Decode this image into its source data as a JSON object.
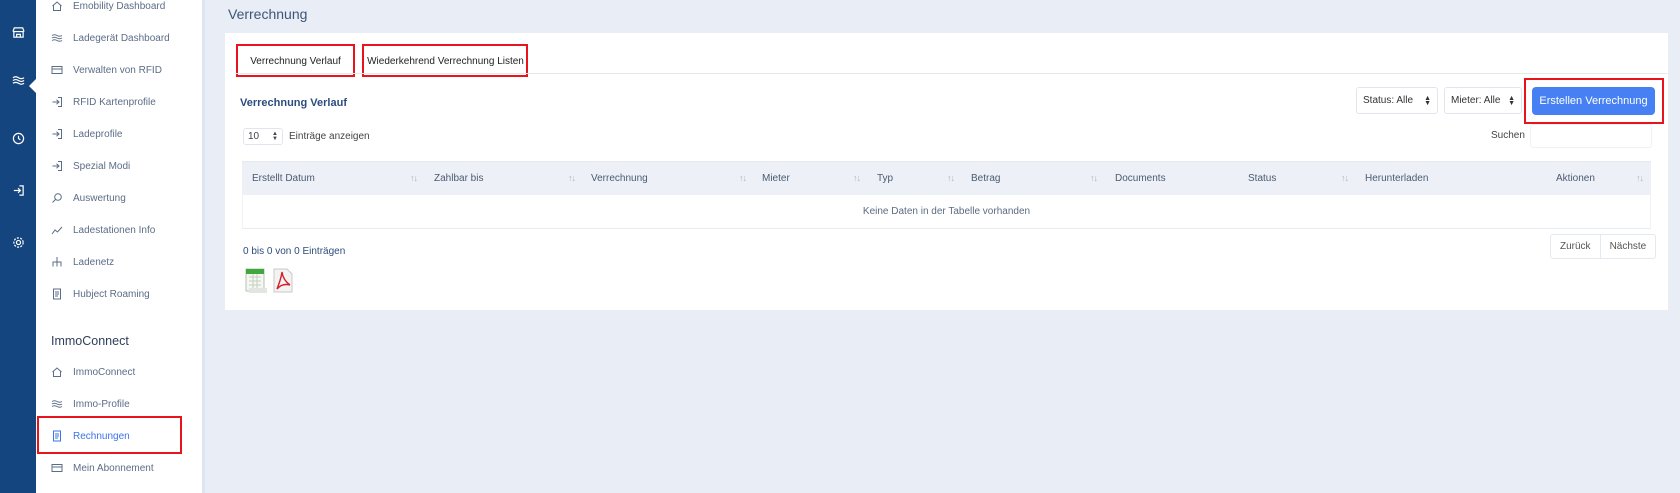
{
  "sidebar": {
    "items_top": [
      {
        "label": "Emobility Dashboard",
        "icon": "home-icon"
      },
      {
        "label": "Ladegerät Dashboard",
        "icon": "waves-icon"
      },
      {
        "label": "Verwalten von RFID",
        "icon": "card-icon"
      },
      {
        "label": "RFID Kartenprofile",
        "icon": "login-icon"
      },
      {
        "label": "Ladeprofile",
        "icon": "login-icon"
      },
      {
        "label": "Spezial Modi",
        "icon": "login-icon"
      },
      {
        "label": "Auswertung",
        "icon": "search-icon"
      },
      {
        "label": "Ladestationen Info",
        "icon": "chart-line-icon"
      },
      {
        "label": "Ladenetz",
        "icon": "network-icon"
      },
      {
        "label": "Hubject Roaming",
        "icon": "document-icon"
      }
    ],
    "section": "ImmoConnect",
    "items_bottom": [
      {
        "label": "ImmoConnect",
        "icon": "home-icon"
      },
      {
        "label": "Immo-Profile",
        "icon": "waves-icon"
      },
      {
        "label": "Rechnungen",
        "icon": "document-icon"
      },
      {
        "label": "Mein Abonnement",
        "icon": "card-icon"
      }
    ]
  },
  "page": {
    "title": "Verrechnung"
  },
  "tabs": [
    "Verrechnung Verlauf",
    "Wiederkehrend Verrechnung Listen"
  ],
  "section_title": "Verrechnung Verlauf",
  "filters": {
    "status": "Status: Alle",
    "mieter": "Mieter: Alle"
  },
  "create_button": "Erstellen Verrechnung",
  "entries": {
    "value": "10",
    "label": "Einträge anzeigen"
  },
  "search": {
    "label": "Suchen",
    "value": ""
  },
  "table": {
    "columns": [
      "Erstellt Datum",
      "Zahlbar bis",
      "Verrechnung",
      "Mieter",
      "Typ",
      "Betrag",
      "Documents",
      "Status",
      "Herunterladen",
      "Aktionen"
    ],
    "empty": "Keine Daten in der Tabelle vorhanden"
  },
  "info": "0 bis 0 von 0 Einträgen",
  "pager": {
    "prev": "Zurück",
    "next": "Nächste"
  },
  "exports": [
    "excel-export-icon",
    "pdf-export-icon"
  ],
  "colors": {
    "rail": "#15457e",
    "accent": "#4680f2",
    "highlight": "#e8141b",
    "active": "#3b73e8"
  }
}
